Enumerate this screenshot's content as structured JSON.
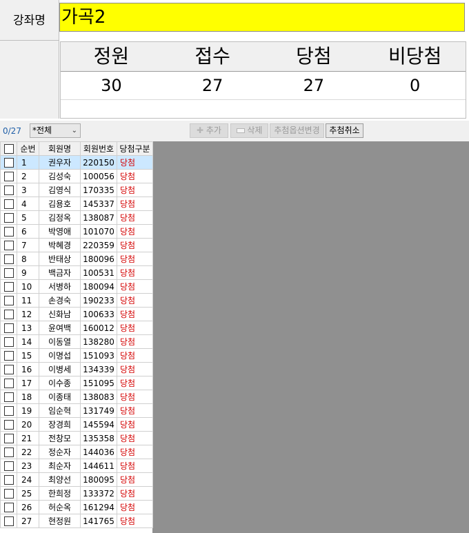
{
  "course": {
    "label": "강좌명",
    "value": "가곡2"
  },
  "stats": {
    "headers": [
      "정원",
      "접수",
      "당첨",
      "비당첨"
    ],
    "values": [
      "30",
      "27",
      "27",
      "0"
    ]
  },
  "toolbar": {
    "count": "0/27",
    "filter_value": "*전체",
    "add_label": "추가",
    "delete_label": "삭제",
    "change_option_label": "추첨옵션변경",
    "cancel_draw_label": "추첨취소"
  },
  "table": {
    "columns": [
      "순번",
      "회원명",
      "회원번호",
      "당첨구분"
    ],
    "rows": [
      {
        "no": "1",
        "name": "권우자",
        "member_no": "220150",
        "status": "당첨"
      },
      {
        "no": "2",
        "name": "김성숙",
        "member_no": "100056",
        "status": "당첨"
      },
      {
        "no": "3",
        "name": "김영식",
        "member_no": "170335",
        "status": "당첨"
      },
      {
        "no": "4",
        "name": "김용호",
        "member_no": "145337",
        "status": "당첨"
      },
      {
        "no": "5",
        "name": "김정옥",
        "member_no": "138087",
        "status": "당첨"
      },
      {
        "no": "6",
        "name": "박영애",
        "member_no": "101070",
        "status": "당첨"
      },
      {
        "no": "7",
        "name": "박혜경",
        "member_no": "220359",
        "status": "당첨"
      },
      {
        "no": "8",
        "name": "반태상",
        "member_no": "180096",
        "status": "당첨"
      },
      {
        "no": "9",
        "name": "백금자",
        "member_no": "100531",
        "status": "당첨"
      },
      {
        "no": "10",
        "name": "서병하",
        "member_no": "180094",
        "status": "당첨"
      },
      {
        "no": "11",
        "name": "손경숙",
        "member_no": "190233",
        "status": "당첨"
      },
      {
        "no": "12",
        "name": "신화남",
        "member_no": "100633",
        "status": "당첨"
      },
      {
        "no": "13",
        "name": "윤여백",
        "member_no": "160012",
        "status": "당첨"
      },
      {
        "no": "14",
        "name": "이동열",
        "member_no": "138280",
        "status": "당첨"
      },
      {
        "no": "15",
        "name": "이명섭",
        "member_no": "151093",
        "status": "당첨"
      },
      {
        "no": "16",
        "name": "이병세",
        "member_no": "134339",
        "status": "당첨"
      },
      {
        "no": "17",
        "name": "이수종",
        "member_no": "151095",
        "status": "당첨"
      },
      {
        "no": "18",
        "name": "이종태",
        "member_no": "138083",
        "status": "당첨"
      },
      {
        "no": "19",
        "name": "임순혁",
        "member_no": "131749",
        "status": "당첨"
      },
      {
        "no": "20",
        "name": "장경희",
        "member_no": "145594",
        "status": "당첨"
      },
      {
        "no": "21",
        "name": "전창모",
        "member_no": "135358",
        "status": "당첨"
      },
      {
        "no": "22",
        "name": "정순자",
        "member_no": "144036",
        "status": "당첨"
      },
      {
        "no": "23",
        "name": "최순자",
        "member_no": "144611",
        "status": "당첨"
      },
      {
        "no": "24",
        "name": "최양선",
        "member_no": "180095",
        "status": "당첨"
      },
      {
        "no": "25",
        "name": "한희정",
        "member_no": "133372",
        "status": "당첨"
      },
      {
        "no": "26",
        "name": "허순옥",
        "member_no": "161294",
        "status": "당첨"
      },
      {
        "no": "27",
        "name": "현정원",
        "member_no": "141765",
        "status": "당첨"
      }
    ]
  },
  "colors": {
    "course_bg": "#ffff00",
    "status_text": "#d40000",
    "selected_row": "#cce8ff",
    "empty_pane": "#909090"
  }
}
